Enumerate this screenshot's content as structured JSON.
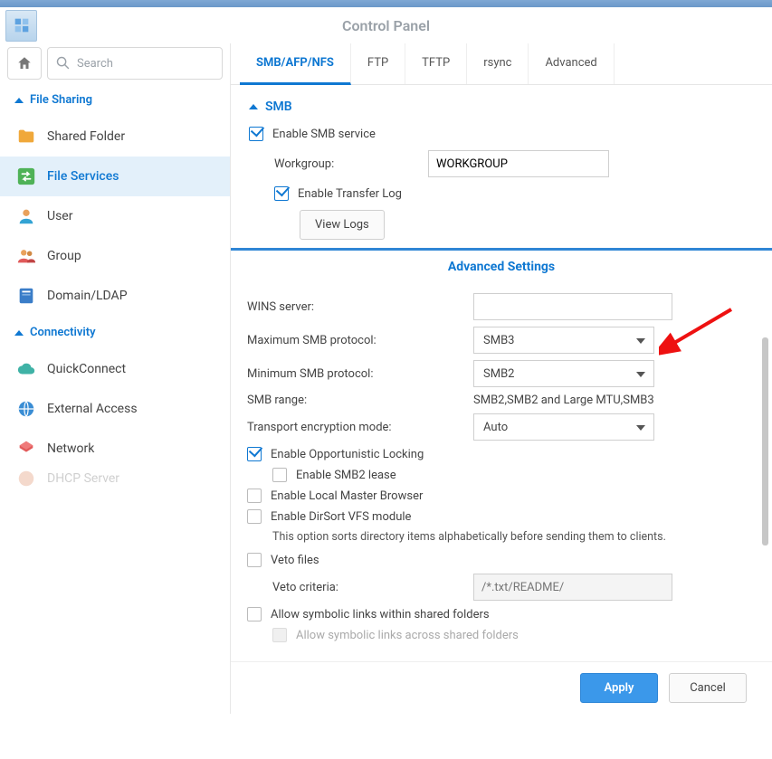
{
  "app_title": "Control Panel",
  "search": {
    "placeholder": "Search"
  },
  "sidebar": {
    "sections": [
      {
        "label": "File Sharing",
        "items": [
          {
            "label": "Shared Folder",
            "icon": "folder-icon"
          },
          {
            "label": "File Services",
            "icon": "swap-icon",
            "active": true
          },
          {
            "label": "User",
            "icon": "user-icon"
          },
          {
            "label": "Group",
            "icon": "group-icon"
          },
          {
            "label": "Domain/LDAP",
            "icon": "book-icon"
          }
        ]
      },
      {
        "label": "Connectivity",
        "items": [
          {
            "label": "QuickConnect",
            "icon": "cloud-icon"
          },
          {
            "label": "External Access",
            "icon": "globe-icon"
          },
          {
            "label": "Network",
            "icon": "network-icon"
          },
          {
            "label": "DHCP Server",
            "icon": "dhcp-icon",
            "cut": true
          }
        ]
      }
    ]
  },
  "tabs": [
    "SMB/AFP/NFS",
    "FTP",
    "TFTP",
    "rsync",
    "Advanced"
  ],
  "smb": {
    "section_title": "SMB",
    "enable_label": "Enable SMB service",
    "workgroup_label": "Workgroup:",
    "workgroup_value": "WORKGROUP",
    "transfer_log_label": "Enable Transfer Log",
    "view_logs_btn": "View Logs",
    "advanced_btn": "Advanced Settings"
  },
  "modal": {
    "title": "Advanced Settings",
    "wins_label": "WINS server:",
    "wins_value": "",
    "max_proto_label": "Maximum SMB protocol:",
    "max_proto_value": "SMB3",
    "min_proto_label": "Minimum SMB protocol:",
    "min_proto_value": "SMB2",
    "range_label": "SMB range:",
    "range_value": "SMB2,SMB2 and Large MTU,SMB3",
    "enc_label": "Transport encryption mode:",
    "enc_value": "Auto",
    "oplock_label": "Enable Opportunistic Locking",
    "smb2lease_label": "Enable SMB2 lease",
    "localmaster_label": "Enable Local Master Browser",
    "dirsort_label": "Enable DirSort VFS module",
    "dirsort_note": "This option sorts directory items alphabetically before sending them to clients.",
    "veto_label": "Veto files",
    "veto_criteria_label": "Veto criteria:",
    "veto_criteria_placeholder": "/*.txt/README/",
    "symlinks_within_label": "Allow symbolic links within shared folders",
    "symlinks_across_label": "Allow symbolic links across shared folders",
    "apply_btn": "Apply",
    "cancel_btn": "Cancel"
  }
}
